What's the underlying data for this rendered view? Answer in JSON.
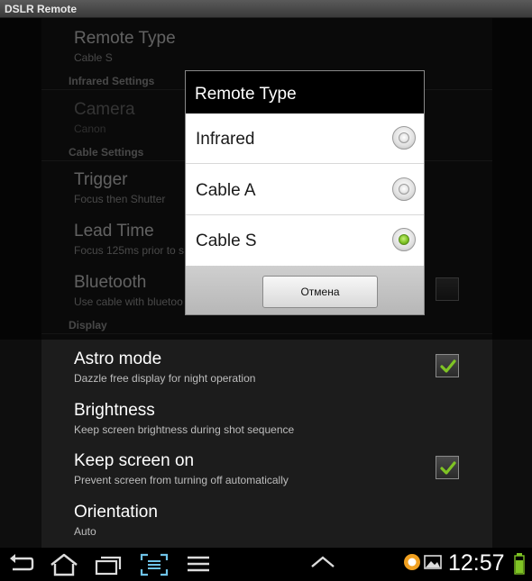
{
  "app": {
    "title": "DSLR Remote"
  },
  "prefs": {
    "remote_type": {
      "title": "Remote Type",
      "summary": "Cable S"
    },
    "infrared_category": "Infrared Settings",
    "camera": {
      "title": "Camera",
      "summary": "Canon"
    },
    "cable_category": "Cable Settings",
    "trigger": {
      "title": "Trigger",
      "summary": "Focus then Shutter"
    },
    "lead_time": {
      "title": "Lead Time",
      "summary": "Focus 125ms prior to s"
    },
    "bluetooth": {
      "title": "Bluetooth",
      "summary": "Use cable with bluetoo"
    },
    "display_category": "Display",
    "astro_mode": {
      "title": "Astro mode",
      "summary": "Dazzle free display for night operation",
      "checked": true
    },
    "brightness": {
      "title": "Brightness",
      "summary": "Keep screen brightness during shot sequence"
    },
    "keep_screen_on": {
      "title": "Keep screen on",
      "summary": "Prevent screen from turning off automatically",
      "checked": true
    },
    "orientation": {
      "title": "Orientation",
      "summary": "Auto"
    }
  },
  "dialog": {
    "title": "Remote Type",
    "options": [
      {
        "label": "Infrared",
        "selected": false
      },
      {
        "label": "Cable A",
        "selected": false
      },
      {
        "label": "Cable S",
        "selected": true
      }
    ],
    "cancel_label": "Отмена"
  },
  "statusbar": {
    "time": "12:57",
    "icons": [
      "back-icon",
      "home-icon",
      "recent-apps-icon",
      "screenshot-icon",
      "menu-icon",
      "expand-up-icon",
      "notification-app-icon",
      "gallery-icon",
      "battery-icon"
    ]
  },
  "colors": {
    "check_green": "#7fc424",
    "panel": "#1c1c1c",
    "dialog_body": "#ffffff"
  }
}
